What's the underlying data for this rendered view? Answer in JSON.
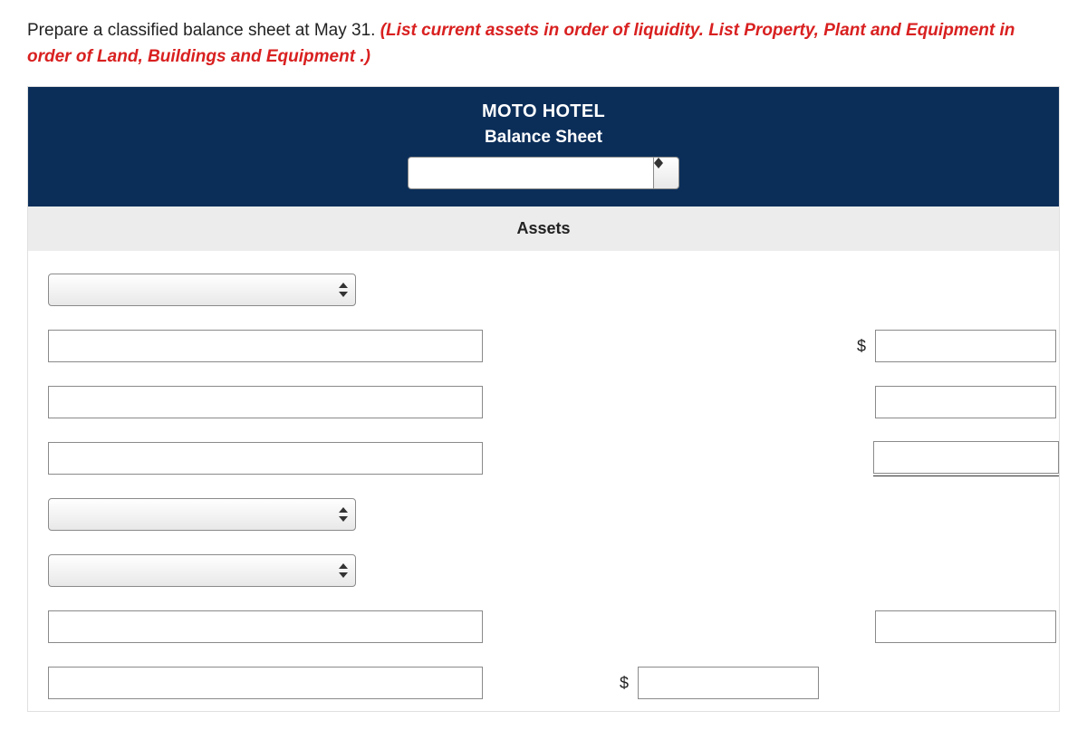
{
  "instruction": {
    "black": "Prepare a classified balance sheet at May 31. ",
    "red": "(List current assets in order of liquidity. List Property, Plant and Equipment in order of Land, Buildings and Equipment .)"
  },
  "header": {
    "company": "MOTO HOTEL",
    "subtitle": "Balance Sheet",
    "date_value": ""
  },
  "section_label": "Assets",
  "currency": "$",
  "rows": [
    {
      "left_type": "dropdown",
      "left_value": "",
      "mid": null,
      "right": null
    },
    {
      "left_type": "text",
      "left_value": "",
      "mid": null,
      "right": {
        "currency": true,
        "value": ""
      }
    },
    {
      "left_type": "text",
      "left_value": "",
      "mid": null,
      "right": {
        "currency": false,
        "value": ""
      }
    },
    {
      "left_type": "text",
      "left_value": "",
      "mid": null,
      "right": {
        "currency": false,
        "value": "",
        "underline": true
      }
    },
    {
      "left_type": "dropdown",
      "left_value": "",
      "mid": null,
      "right": null
    },
    {
      "left_type": "dropdown",
      "left_value": "",
      "mid": null,
      "right": null
    },
    {
      "left_type": "text",
      "left_value": "",
      "mid": null,
      "right": {
        "currency": false,
        "value": ""
      }
    },
    {
      "left_type": "text",
      "left_value": "",
      "mid": {
        "currency": true,
        "value": ""
      },
      "right": null
    }
  ]
}
